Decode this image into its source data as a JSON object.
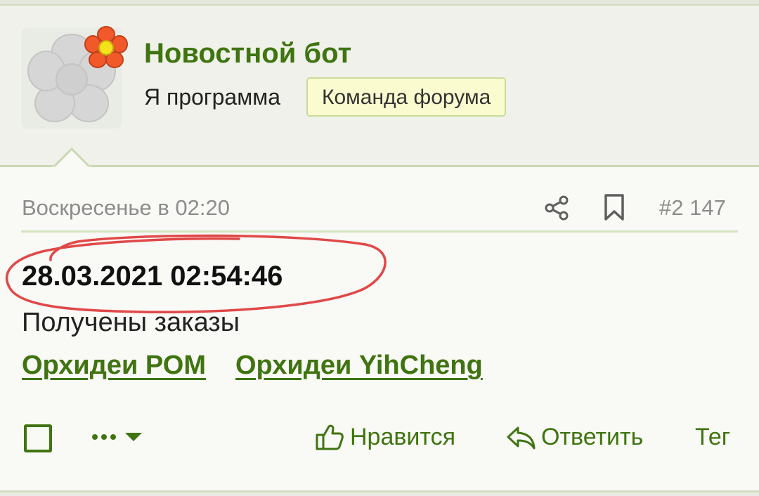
{
  "user": {
    "name": "Новостной бот",
    "title": "Я программа",
    "banner": "Команда форума"
  },
  "post": {
    "date": "Воскресенье в 02:20",
    "number": "#2 147",
    "timestamp": "28.03.2021 02:54:46",
    "text": "Получены заказы",
    "links": [
      "Орхидеи РОМ",
      "Орхидеи YihCheng"
    ]
  },
  "actions": {
    "like": "Нравится",
    "reply": "Ответить",
    "tag": "Тег"
  },
  "icons": {
    "share": "share-icon",
    "bookmark": "bookmark-icon",
    "more": "ellipsis-menu-icon",
    "like": "thumbs-up-icon",
    "reply": "reply-arrow-icon"
  },
  "colors": {
    "accent": "#3f7410",
    "banner_bg": "#fbfbd0",
    "annotation": "#e04848"
  }
}
